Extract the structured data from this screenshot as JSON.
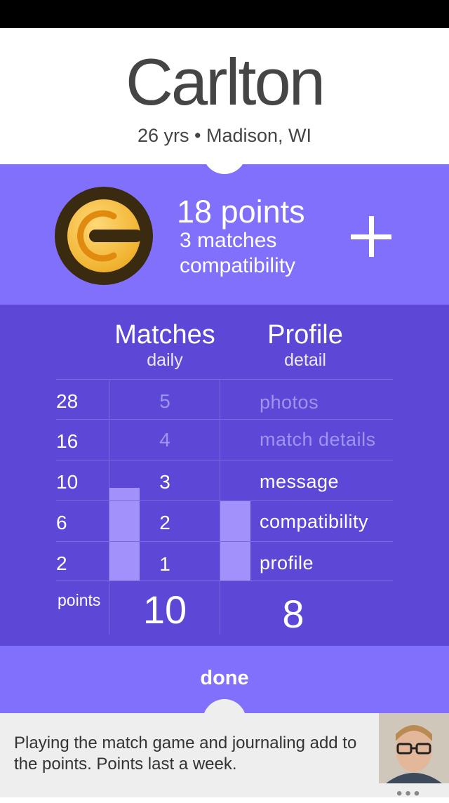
{
  "profile": {
    "name": "Carlton",
    "meta": "26 yrs • Madison, WI"
  },
  "points_summary": {
    "title": "18 points",
    "line1": "3 matches",
    "line2": "compatibility",
    "badge_icon": "coin-badge-icon",
    "add_icon": "plus-icon"
  },
  "table": {
    "matches_header": "Matches",
    "matches_sub": "daily",
    "profile_header": "Profile",
    "profile_sub": "detail",
    "rows": [
      {
        "points": "28",
        "matches": "5",
        "profile": "photos",
        "active": false
      },
      {
        "points": "16",
        "matches": "4",
        "profile": "match details",
        "active": false
      },
      {
        "points": "10",
        "matches": "3",
        "profile": "message",
        "active": true
      },
      {
        "points": "6",
        "matches": "2",
        "profile": "compatibility",
        "active": true
      },
      {
        "points": "2",
        "matches": "1",
        "profile": "profile",
        "active": true
      }
    ],
    "matches_level": 2,
    "profile_level": 2,
    "points_label": "points",
    "matches_total": "10",
    "profile_total": "8"
  },
  "done_label": "done",
  "tip": {
    "text": "Playing the match game and journaling add to the points. Points last a week."
  },
  "colors": {
    "accent": "#8170fc",
    "table_bg": "#5c47d6",
    "bar": "#a291fb"
  }
}
